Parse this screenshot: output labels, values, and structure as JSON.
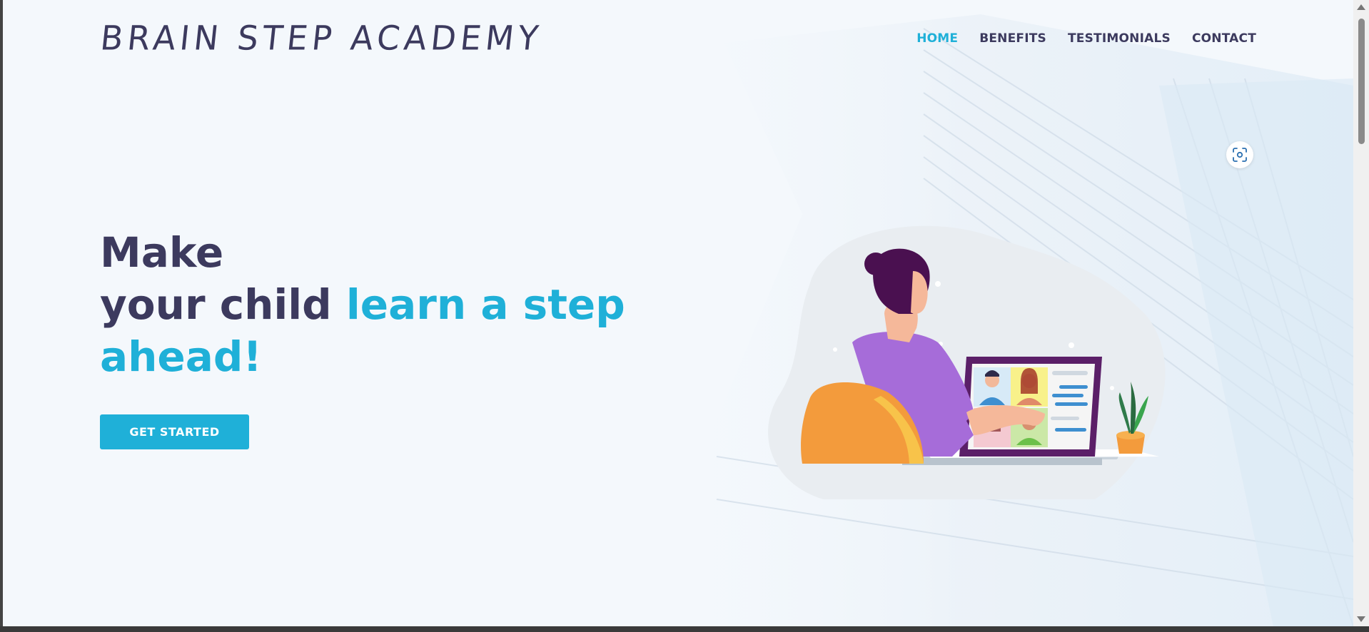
{
  "brand": {
    "name": "BRAIN STEP ACADEMY"
  },
  "nav": {
    "items": [
      {
        "label": "HOME",
        "active": true
      },
      {
        "label": "BENEFITS",
        "active": false
      },
      {
        "label": "TESTIMONIALS",
        "active": false
      },
      {
        "label": "CONTACT",
        "active": false
      }
    ]
  },
  "hero": {
    "line1": "Make",
    "line2_plain": "your child ",
    "line2_accent": "learn a step",
    "line3_accent": "ahead!",
    "cta_label": "GET STARTED"
  },
  "icons": {
    "camera": "screenshot-camera-icon"
  },
  "colors": {
    "accent": "#1fb0d8",
    "text_dark": "#3c3a5e",
    "background": "#f4f8fc"
  }
}
